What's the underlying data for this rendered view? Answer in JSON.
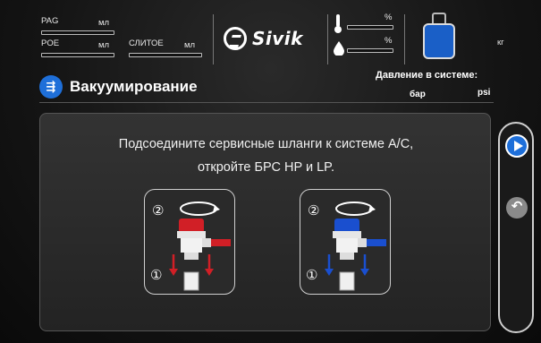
{
  "header": {
    "pag_label": "PAG",
    "pag_unit": "мл",
    "poe_label": "POE",
    "poe_unit": "мл",
    "drain_label": "СЛИТОЕ",
    "drain_unit": "мл",
    "brand": "Sivik",
    "temp_unit": "%",
    "humidity_unit": "%",
    "tank_unit": "кг"
  },
  "title": {
    "icon": "vacuum-icon",
    "text": "Вакуумирование"
  },
  "pressure": {
    "label": "Давление в системе:",
    "unit_bar": "бар",
    "unit_psi": "psi"
  },
  "main": {
    "instruction_line1": "Подсоедините сервисные шланги к системе А/С,",
    "instruction_line2": "откройте БРС HP и LP.",
    "cards": [
      {
        "step_rotate": "②",
        "step_push": "①",
        "color": "#d11f26"
      },
      {
        "step_rotate": "②",
        "step_push": "①",
        "color": "#1a4fcf"
      }
    ]
  },
  "colors": {
    "accent": "#1e6fd9",
    "hp": "#d11f26",
    "lp": "#1a4fcf"
  },
  "nav": {
    "next_icon": "play-icon",
    "back_icon": "back-arrow-icon"
  }
}
